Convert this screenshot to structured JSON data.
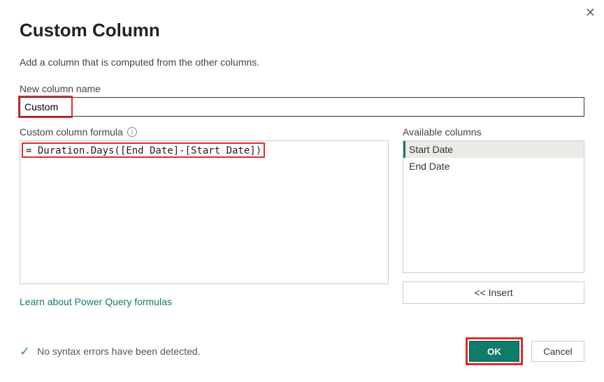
{
  "dialog": {
    "title": "Custom Column",
    "subtitle": "Add a column that is computed from the other columns.",
    "name_label": "New column name",
    "name_value": "Custom",
    "formula_label": "Custom column formula",
    "formula_value": "= Duration.Days([End Date]-[Start Date])",
    "learn_link": "Learn about Power Query formulas"
  },
  "available": {
    "label": "Available columns",
    "items": [
      "Start Date",
      "End Date"
    ],
    "selected_index": 0,
    "insert_label": "<< Insert"
  },
  "status": {
    "text": "No syntax errors have been detected."
  },
  "buttons": {
    "ok": "OK",
    "cancel": "Cancel"
  }
}
